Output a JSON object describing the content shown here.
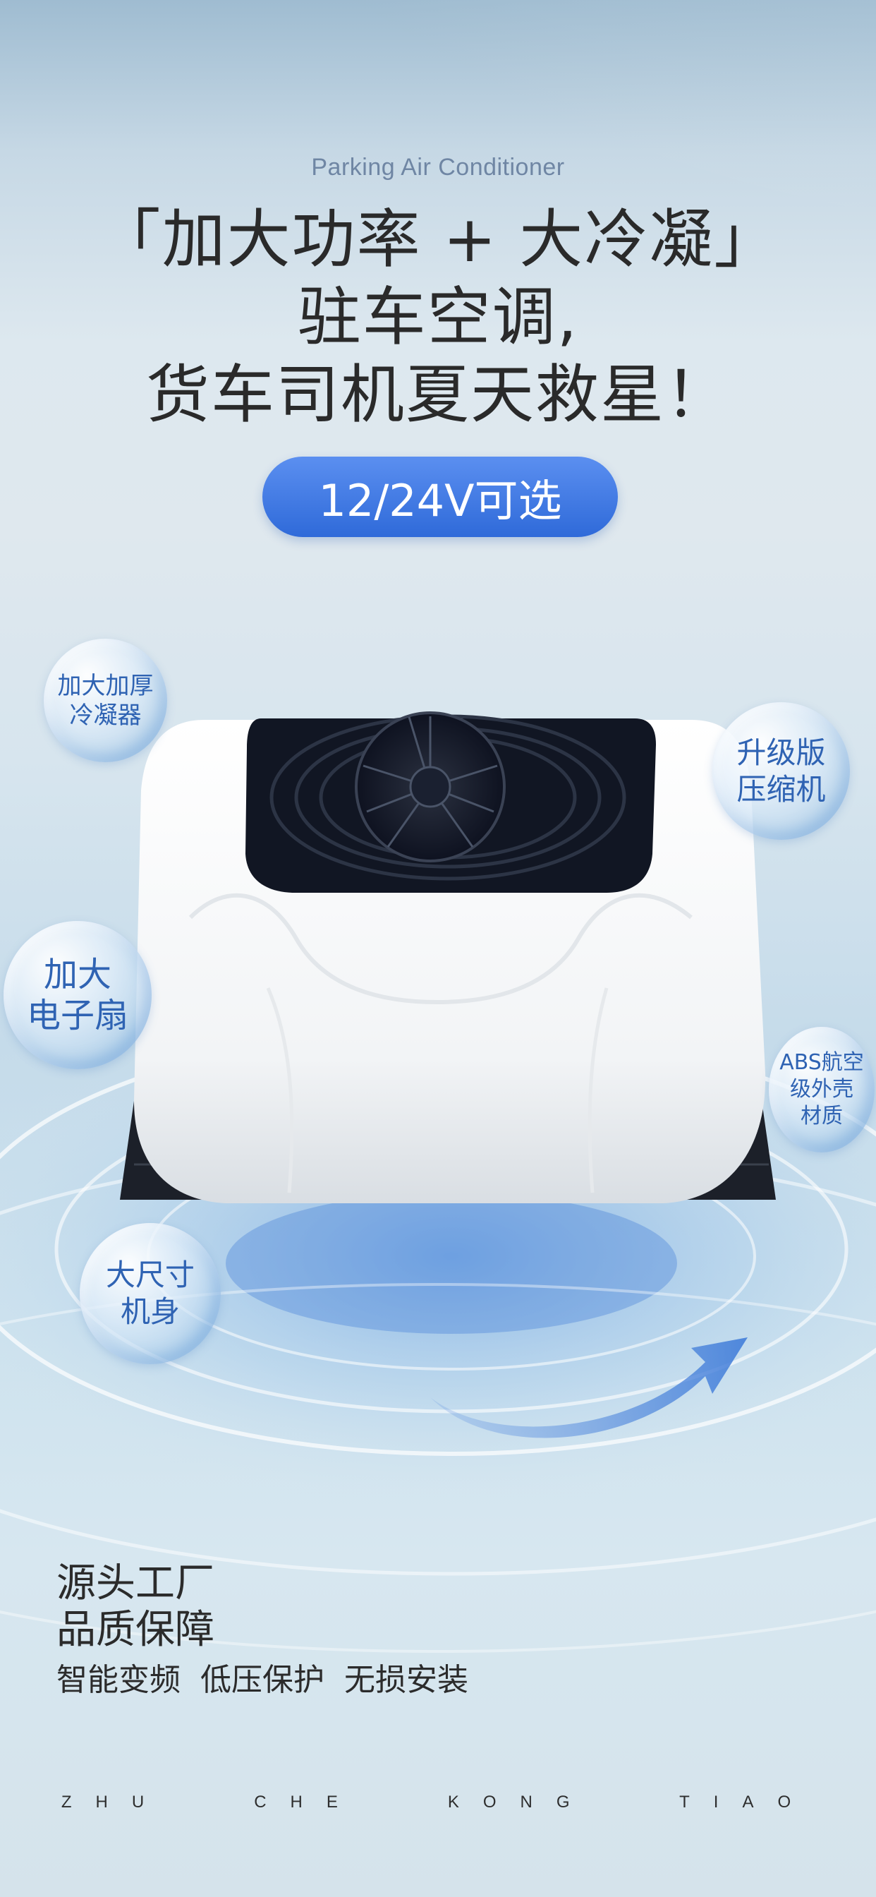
{
  "subtitle": "Parking Air Conditioner",
  "headline": {
    "line1": "「加大功率 + 大冷凝」",
    "line2": "驻车空调,",
    "line3": "货车司机夏天救星！"
  },
  "voltage_badge": "12/24V可选",
  "features": {
    "condenser": "加大加厚\n冷凝器",
    "compressor": "升级版\n压缩机",
    "fan": "加大\n电子扇",
    "shell": "ABS航空\n级外壳\n材质",
    "body_size": "大尺寸\n机身"
  },
  "bottom": {
    "line1": "源头工厂",
    "line2": "品质保障",
    "line3": "智能变频  低压保护  无损安装"
  },
  "footer": "ZHU   CHE   KONG   TIAO",
  "colors": {
    "accent": "#2f6ad9",
    "feature_text": "#2f63b3",
    "headline": "#2a2a2a",
    "subtitle": "#6f86a4"
  }
}
